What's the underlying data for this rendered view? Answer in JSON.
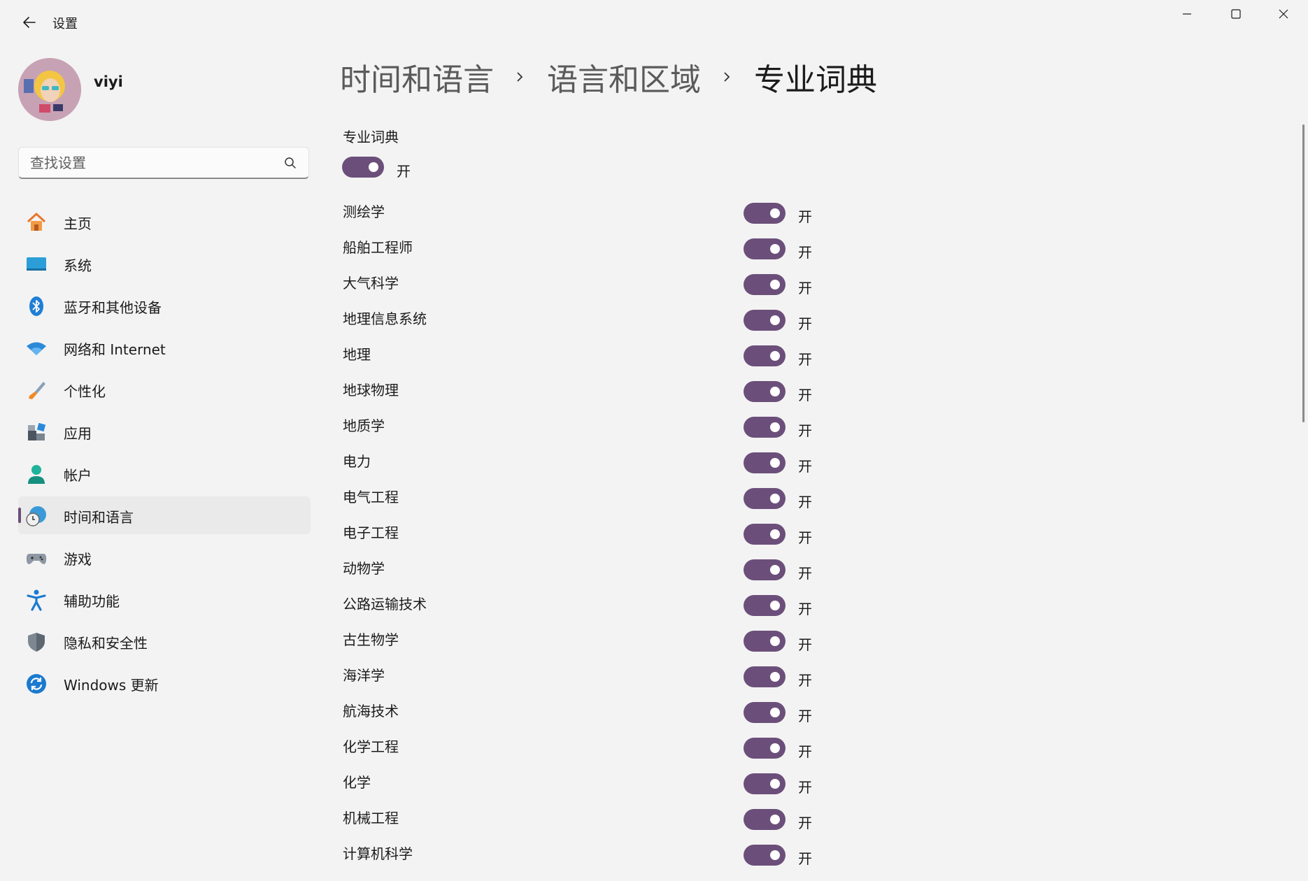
{
  "window": {
    "title": "设置",
    "controls": {
      "minimize": "minimize-icon",
      "maximize": "maximize-icon",
      "close": "close-icon"
    }
  },
  "user": {
    "name": "viyi"
  },
  "search": {
    "placeholder": "查找设置",
    "value": ""
  },
  "sidebar": {
    "items": [
      {
        "label": "主页",
        "icon": "home-icon"
      },
      {
        "label": "系统",
        "icon": "system-icon"
      },
      {
        "label": "蓝牙和其他设备",
        "icon": "bluetooth-icon"
      },
      {
        "label": "网络和 Internet",
        "icon": "wifi-icon"
      },
      {
        "label": "个性化",
        "icon": "brush-icon"
      },
      {
        "label": "应用",
        "icon": "apps-icon"
      },
      {
        "label": "帐户",
        "icon": "account-icon"
      },
      {
        "label": "时间和语言",
        "icon": "time-language-icon",
        "active": true
      },
      {
        "label": "游戏",
        "icon": "gamepad-icon"
      },
      {
        "label": "辅助功能",
        "icon": "accessibility-icon"
      },
      {
        "label": "隐私和安全性",
        "icon": "shield-icon"
      },
      {
        "label": "Windows 更新",
        "icon": "update-icon"
      }
    ]
  },
  "breadcrumb": [
    "时间和语言",
    "语言和区域",
    "专业词典"
  ],
  "main": {
    "section_title": "专业词典",
    "master_toggle": {
      "state_label": "开",
      "on": true
    },
    "dictionaries": [
      {
        "label": "测绘学",
        "state": "开"
      },
      {
        "label": "船舶工程师",
        "state": "开"
      },
      {
        "label": "大气科学",
        "state": "开"
      },
      {
        "label": "地理信息系统",
        "state": "开"
      },
      {
        "label": "地理",
        "state": "开"
      },
      {
        "label": "地球物理",
        "state": "开"
      },
      {
        "label": "地质学",
        "state": "开"
      },
      {
        "label": "电力",
        "state": "开"
      },
      {
        "label": "电气工程",
        "state": "开"
      },
      {
        "label": "电子工程",
        "state": "开"
      },
      {
        "label": "动物学",
        "state": "开"
      },
      {
        "label": "公路运输技术",
        "state": "开"
      },
      {
        "label": "古生物学",
        "state": "开"
      },
      {
        "label": "海洋学",
        "state": "开"
      },
      {
        "label": "航海技术",
        "state": "开"
      },
      {
        "label": "化学工程",
        "state": "开"
      },
      {
        "label": "化学",
        "state": "开"
      },
      {
        "label": "机械工程",
        "state": "开"
      },
      {
        "label": "计算机科学",
        "state": "开"
      }
    ]
  },
  "colors": {
    "accent": "#6b4f7a",
    "background": "#f3f3f3",
    "active_nav": "#eaeaea"
  }
}
